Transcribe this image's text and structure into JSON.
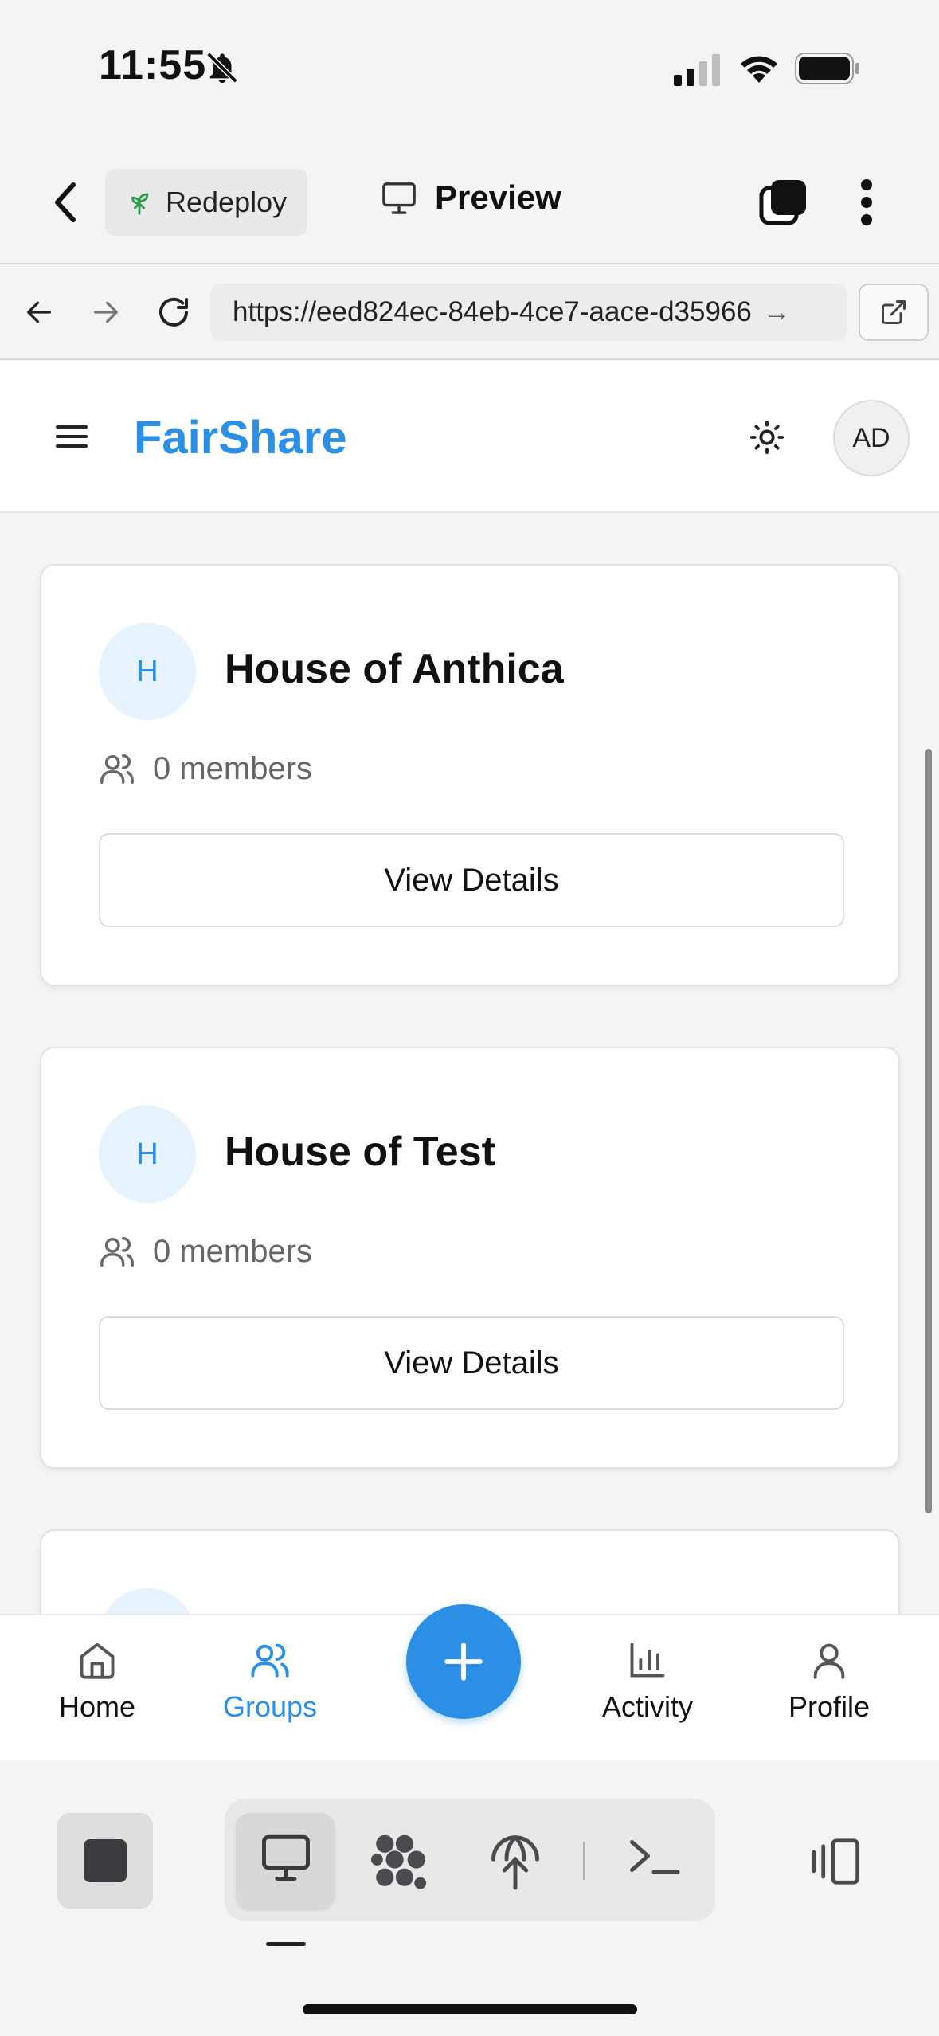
{
  "status_bar": {
    "time": "11:55"
  },
  "app_header": {
    "redeploy_label": "Redeploy",
    "preview_label": "Preview"
  },
  "browser": {
    "url": "https://eed824ec-84eb-4ce7-aace-d35966",
    "url_arrow": "→"
  },
  "webapp": {
    "brand": "FairShare",
    "user_initials": "AD",
    "groups": [
      {
        "initial": "H",
        "name": "House of Anthica",
        "members": "0 members",
        "button": "View Details"
      },
      {
        "initial": "H",
        "name": "House of Test",
        "members": "0 members",
        "button": "View Details"
      }
    ]
  },
  "bottom_nav": {
    "home": "Home",
    "groups": "Groups",
    "activity": "Activity",
    "profile": "Profile"
  },
  "colors": {
    "accent": "#2b8fe6",
    "active_nav": "#2b8fe6"
  },
  "icons": [
    "bell-slash-icon",
    "signal-icon",
    "wifi-icon",
    "battery-icon",
    "chevron-left-icon",
    "sprout-icon",
    "monitor-icon",
    "tabs-icon",
    "more-vertical-icon",
    "arrow-left-icon",
    "arrow-right-icon",
    "reload-icon",
    "external-link-icon",
    "menu-icon",
    "sun-icon",
    "users-icon",
    "home-icon",
    "plus-icon",
    "bar-chart-icon",
    "user-icon",
    "stop-icon",
    "cluster-icon",
    "antenna-icon",
    "terminal-icon",
    "panel-icon"
  ]
}
